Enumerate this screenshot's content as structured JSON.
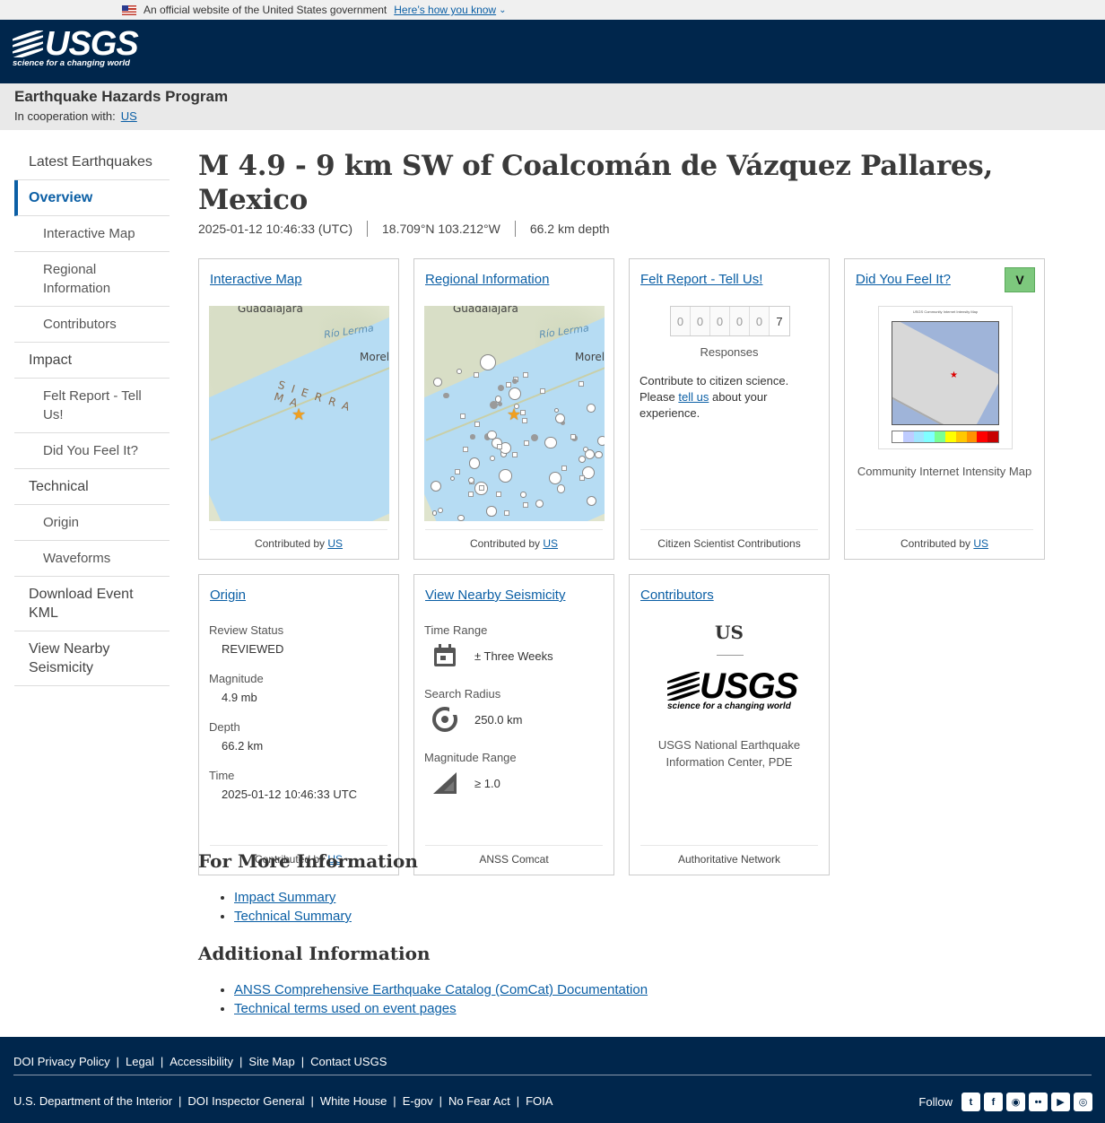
{
  "gov_banner": {
    "text": "An official website of the United States government",
    "link": "Here’s how you know"
  },
  "brand": {
    "logo_word": "USGS",
    "logo_tagline": "science for a changing world"
  },
  "program": {
    "title": "Earthquake Hazards Program",
    "coop_label": "In cooperation with:",
    "coop_link": "US"
  },
  "sidebar": {
    "items": [
      {
        "label": "Latest Earthquakes"
      },
      {
        "label": "Overview"
      },
      {
        "label": "Interactive Map"
      },
      {
        "label": "Regional Information"
      },
      {
        "label": "Contributors"
      },
      {
        "label": "Impact"
      },
      {
        "label": "Felt Report - Tell Us!"
      },
      {
        "label": "Did You Feel It?"
      },
      {
        "label": "Technical"
      },
      {
        "label": "Origin"
      },
      {
        "label": "Waveforms"
      },
      {
        "label": "Download Event KML"
      },
      {
        "label": "View Nearby Seismicity"
      }
    ]
  },
  "event": {
    "title": "M 4.9 - 9 km SW of Coalcomán de Vázquez Pallares, Mexico",
    "time": "2025-01-12 10:46:33 (UTC)",
    "location": "18.709°N 103.212°W",
    "depth": "66.2 km depth"
  },
  "cards": {
    "interactive_map": {
      "title": "Interactive Map",
      "contributed_prefix": "Contributed by",
      "contributed_link": "US",
      "labels": {
        "city1": "Guadalajara",
        "city2": "Morel",
        "river": "Río Lerma",
        "range": "SIERRA MA"
      }
    },
    "regional": {
      "title": "Regional Information",
      "contributed_prefix": "Contributed by",
      "contributed_link": "US",
      "labels": {
        "city1": "Guadalajara",
        "city2": "Morel",
        "river": "Río Lerma"
      }
    },
    "felt_report": {
      "title": "Felt Report - Tell Us!",
      "digits": [
        "0",
        "0",
        "0",
        "0",
        "0",
        "7"
      ],
      "responses_label": "Responses",
      "text_before": "Contribute to citizen science. Please",
      "text_link": "tell us",
      "text_after": "about your experience.",
      "footer": "Citizen Scientist Contributions"
    },
    "dyfi": {
      "title": "Did You Feel It?",
      "intensity": "V",
      "map_title": "USGS Community Internet Intensity Map",
      "caption": "Community Internet Intensity Map",
      "contributed_prefix": "Contributed by",
      "contributed_link": "US"
    },
    "origin": {
      "title": "Origin",
      "rows": [
        {
          "label": "Review Status",
          "value": "REVIEWED"
        },
        {
          "label": "Magnitude",
          "value": "4.9 mb"
        },
        {
          "label": "Depth",
          "value": "66.2 km"
        },
        {
          "label": "Time",
          "value": "2025-01-12 10:46:33 UTC"
        }
      ],
      "contributed_prefix": "Contributed by",
      "contributed_link": "US"
    },
    "seismicity": {
      "title": "View Nearby Seismicity",
      "rows": [
        {
          "label": "Time Range",
          "value": "± Three Weeks"
        },
        {
          "label": "Search Radius",
          "value": "250.0 km"
        },
        {
          "label": "Magnitude Range",
          "value": "≥ 1.0"
        }
      ],
      "footer": "ANSS Comcat"
    },
    "contributors": {
      "title": "Contributors",
      "network": "US",
      "name": "USGS National Earthquake Information Center, PDE",
      "footer": "Authoritative Network"
    }
  },
  "more_info": {
    "heading": "For More Information",
    "links": [
      "Impact Summary",
      "Technical Summary"
    ]
  },
  "additional_info": {
    "heading": "Additional Information",
    "links": [
      "ANSS Comprehensive Earthquake Catalog (ComCat) Documentation",
      "Technical terms used on event pages"
    ]
  },
  "footer": {
    "row1": [
      "DOI Privacy Policy",
      "Legal",
      "Accessibility",
      "Site Map",
      "Contact USGS"
    ],
    "row2": [
      "U.S. Department of the Interior",
      "DOI Inspector General",
      "White House",
      "E-gov",
      "No Fear Act",
      "FOIA"
    ],
    "follow_label": "Follow",
    "social": [
      "twitter-icon",
      "facebook-icon",
      "github-icon",
      "flickr-icon",
      "youtube-icon",
      "instagram-icon"
    ]
  },
  "colors": {
    "header_bg": "#00264c",
    "link": "#0b5fa5",
    "dyfi_badge": "#7dc87d"
  }
}
